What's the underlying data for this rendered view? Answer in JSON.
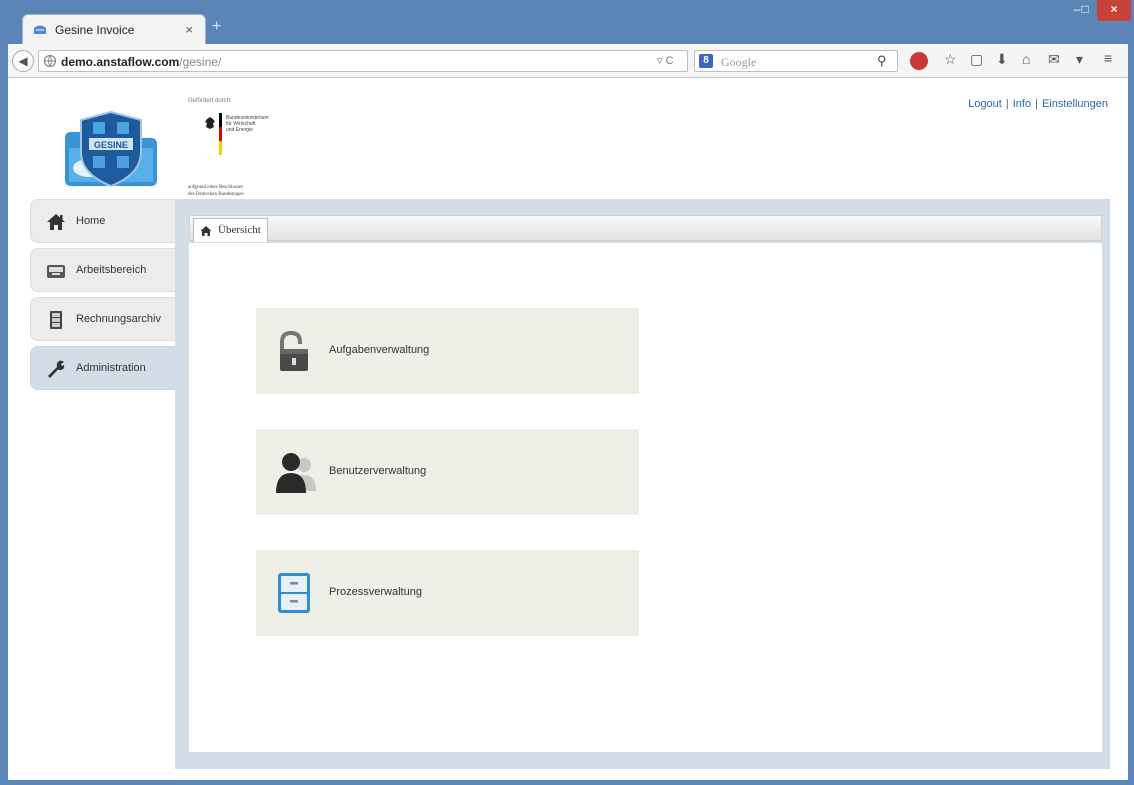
{
  "browser": {
    "tab_title": "Gesine Invoice",
    "tab_close": "×",
    "new_tab": "+",
    "url_host": "demo.anstaflow.com",
    "url_path": "/gesine/",
    "url_controls": "▿ C",
    "search_engine_badge": "8",
    "search_placeholder": "Google",
    "window_min": "–",
    "window_max": "□",
    "window_close": "×"
  },
  "header": {
    "sponsor_pre": "Gefördert durch:",
    "ministry": "Bundesministerium\nfür Wirtschaft\nund Energie",
    "sponsor_post": "aufgrund eines Beschlusses\ndes Deutschen Bundestages",
    "links": {
      "logout": "Logout",
      "info": "Info",
      "settings": "Einstellungen",
      "separator": "|"
    }
  },
  "sidebar": {
    "items": [
      {
        "label": "Home",
        "icon": "home-icon"
      },
      {
        "label": "Arbeitsbereich",
        "icon": "inbox-tray-icon"
      },
      {
        "label": "Rechnungsarchiv",
        "icon": "archive-cabinet-icon"
      },
      {
        "label": "Administration",
        "icon": "wrench-icon",
        "active": true
      }
    ]
  },
  "main": {
    "tab_label": "Übersicht",
    "tiles": [
      {
        "label": "Aufgabenverwaltung",
        "icon": "padlock-icon"
      },
      {
        "label": "Benutzerverwaltung",
        "icon": "users-icon"
      },
      {
        "label": "Prozessverwaltung",
        "icon": "filing-cabinet-icon"
      }
    ]
  },
  "colors": {
    "accent_link": "#2b66b1",
    "panel_frame": "#d2dde7",
    "tile_bg": "#eef0e8",
    "window_titlebar": "#5a85b6",
    "window_close": "#c9423a"
  }
}
